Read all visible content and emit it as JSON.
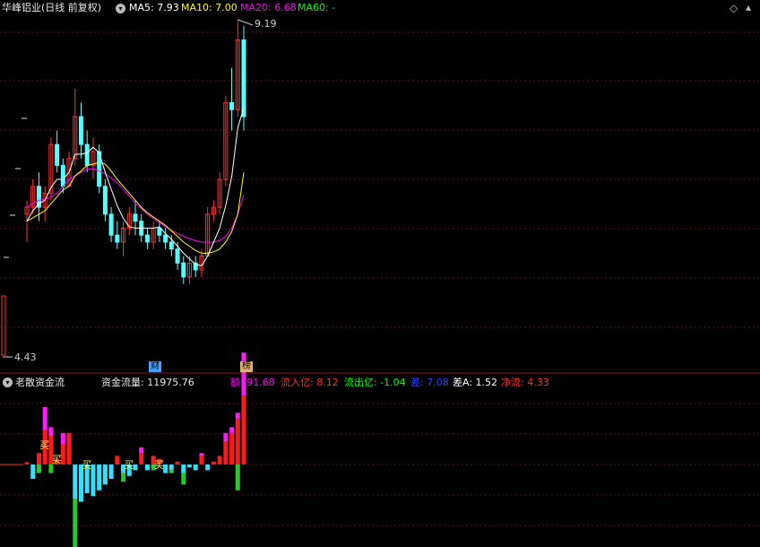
{
  "header": {
    "title": "华峰铝业(日线 前复权)",
    "ma": [
      {
        "label": "MA5: 7.93",
        "color": "#ffffff"
      },
      {
        "label": "MA10: 7.00",
        "color": "#ffff00"
      },
      {
        "label": "MA20: 6.68",
        "color": "#ff00ff"
      },
      {
        "label": "MA60: -",
        "color": "#00ff00"
      }
    ]
  },
  "price_markers": {
    "high": "9.19",
    "low": "4.43"
  },
  "event_badges": {
    "cai": "财",
    "bang": "榜"
  },
  "indicator": {
    "title": "老散资金流",
    "flow_label": "资金流量: 11975.76",
    "stats": [
      {
        "label": "额: 91.68",
        "color": "#ff00ff"
      },
      {
        "label": "流入亿: 8.12",
        "color": "#ff3030"
      },
      {
        "label": "流出亿: -1.04",
        "color": "#00ff00"
      },
      {
        "label": "差: 7.08",
        "color": "#3040ff"
      },
      {
        "label": "差A: 1.52",
        "color": "#ffffff"
      },
      {
        "label": "净流: 4.33",
        "color": "#ff3030"
      }
    ],
    "buy_label": "买"
  },
  "chart_data": [
    {
      "type": "candlestick",
      "title": "华峰铝业(日线 前复权)",
      "ylim": [
        4.43,
        9.19
      ],
      "candles": [
        [
          6.4,
          6.6,
          6.0,
          6.5
        ],
        [
          6.5,
          6.9,
          6.4,
          6.8
        ],
        [
          6.8,
          7.0,
          6.3,
          6.5
        ],
        [
          6.5,
          6.8,
          6.3,
          6.7
        ],
        [
          6.7,
          7.5,
          6.6,
          7.4
        ],
        [
          7.4,
          7.6,
          7.0,
          7.1
        ],
        [
          7.1,
          7.2,
          6.7,
          6.8
        ],
        [
          6.8,
          7.3,
          6.8,
          7.2
        ],
        [
          7.2,
          8.2,
          7.1,
          7.8
        ],
        [
          7.8,
          8.0,
          7.2,
          7.4
        ],
        [
          7.4,
          7.6,
          7.0,
          7.1
        ],
        [
          7.1,
          7.5,
          6.9,
          7.3
        ],
        [
          7.3,
          7.4,
          6.7,
          6.8
        ],
        [
          6.8,
          6.9,
          6.3,
          6.4
        ],
        [
          6.4,
          6.5,
          6.0,
          6.1
        ],
        [
          6.1,
          6.3,
          5.9,
          6.0
        ],
        [
          6.0,
          6.3,
          5.8,
          6.2
        ],
        [
          6.2,
          6.5,
          6.1,
          6.4
        ],
        [
          6.4,
          6.6,
          6.1,
          6.3
        ],
        [
          6.3,
          6.4,
          6.0,
          6.1
        ],
        [
          6.1,
          6.2,
          5.9,
          6.0
        ],
        [
          6.0,
          6.3,
          5.9,
          6.2
        ],
        [
          6.2,
          6.3,
          6.0,
          6.1
        ],
        [
          6.1,
          6.2,
          5.9,
          6.0
        ],
        [
          6.0,
          6.1,
          5.8,
          5.9
        ],
        [
          5.9,
          6.0,
          5.6,
          5.7
        ],
        [
          5.7,
          5.8,
          5.4,
          5.5
        ],
        [
          5.5,
          5.8,
          5.4,
          5.7
        ],
        [
          5.7,
          5.8,
          5.5,
          5.6
        ],
        [
          5.6,
          5.9,
          5.5,
          5.8
        ],
        [
          5.8,
          6.5,
          5.8,
          6.4
        ],
        [
          6.4,
          6.6,
          6.3,
          6.5
        ],
        [
          6.5,
          7.0,
          6.4,
          6.9
        ],
        [
          6.9,
          8.1,
          6.8,
          8.0
        ],
        [
          8.0,
          8.5,
          7.6,
          7.9
        ],
        [
          7.9,
          9.19,
          7.8,
          8.9
        ],
        [
          8.9,
          9.1,
          7.6,
          7.8
        ]
      ],
      "ma5": [
        6.3,
        6.45,
        6.55,
        6.6,
        6.78,
        6.9,
        6.9,
        7.0,
        7.26,
        7.26,
        7.28,
        7.36,
        7.28,
        7.0,
        6.76,
        6.52,
        6.34,
        6.22,
        6.2,
        6.2,
        6.2,
        6.2,
        6.22,
        6.12,
        6.04,
        5.94,
        5.84,
        5.76,
        5.68,
        5.66,
        5.8,
        6.0,
        6.2,
        6.52,
        6.94,
        7.64,
        7.93
      ],
      "ma10": [
        6.3,
        6.35,
        6.4,
        6.45,
        6.55,
        6.65,
        6.75,
        6.8,
        6.95,
        7.02,
        7.1,
        7.12,
        7.14,
        7.12,
        7.02,
        6.9,
        6.8,
        6.7,
        6.6,
        6.5,
        6.42,
        6.36,
        6.3,
        6.24,
        6.16,
        6.08,
        6.0,
        5.94,
        5.88,
        5.84,
        5.84,
        5.86,
        5.9,
        6.0,
        6.15,
        6.4,
        7.0
      ],
      "ma20": [
        6.5,
        6.55,
        6.6,
        6.62,
        6.65,
        6.7,
        6.8,
        6.9,
        6.95,
        7.0,
        7.05,
        7.05,
        7.02,
        6.98,
        6.92,
        6.85,
        6.76,
        6.66,
        6.56,
        6.48,
        6.4,
        6.34,
        6.28,
        6.22,
        6.17,
        6.12,
        6.08,
        6.05,
        6.02,
        6.0,
        6.0,
        6.0,
        6.02,
        6.08,
        6.2,
        6.4,
        6.68
      ]
    },
    {
      "type": "bar",
      "title": "老散资金流",
      "values": [
        0.08,
        -0.5,
        0.4,
        1.2,
        1.0,
        0.2,
        0.7,
        1.1,
        -1.2,
        -1.3,
        -1.0,
        -1.1,
        -0.9,
        -0.7,
        -0.5,
        0.3,
        -0.3,
        -0.4,
        -0.2,
        0.4,
        -0.2,
        0.3,
        0.2,
        -0.3,
        -0.2,
        0.1,
        -0.3,
        -0.1,
        -0.2,
        0.3,
        -0.2,
        0.1,
        0.3,
        0.8,
        1.1,
        1.6,
        2.4
      ],
      "extra_up": [
        0,
        0,
        0,
        0.8,
        0.3,
        0,
        0.4,
        0,
        0,
        0,
        0,
        0,
        0,
        0,
        0,
        0,
        0,
        0,
        0,
        0.2,
        0,
        0,
        0,
        0,
        0,
        0,
        0,
        0,
        0,
        0.1,
        0,
        0,
        0,
        0.3,
        0.2,
        0.2,
        1.5
      ],
      "extra_down": [
        0,
        0,
        -0.3,
        0,
        -0.3,
        0,
        0,
        0,
        -1.8,
        0,
        0,
        0,
        0,
        0,
        0,
        0,
        -0.3,
        0,
        0,
        0,
        0,
        -0.2,
        0,
        0,
        -0.1,
        0,
        -0.4,
        0,
        0,
        0,
        0,
        0,
        0,
        0,
        0,
        -0.9,
        0
      ],
      "buy_marks": [
        3,
        5,
        10,
        17,
        22
      ]
    }
  ]
}
